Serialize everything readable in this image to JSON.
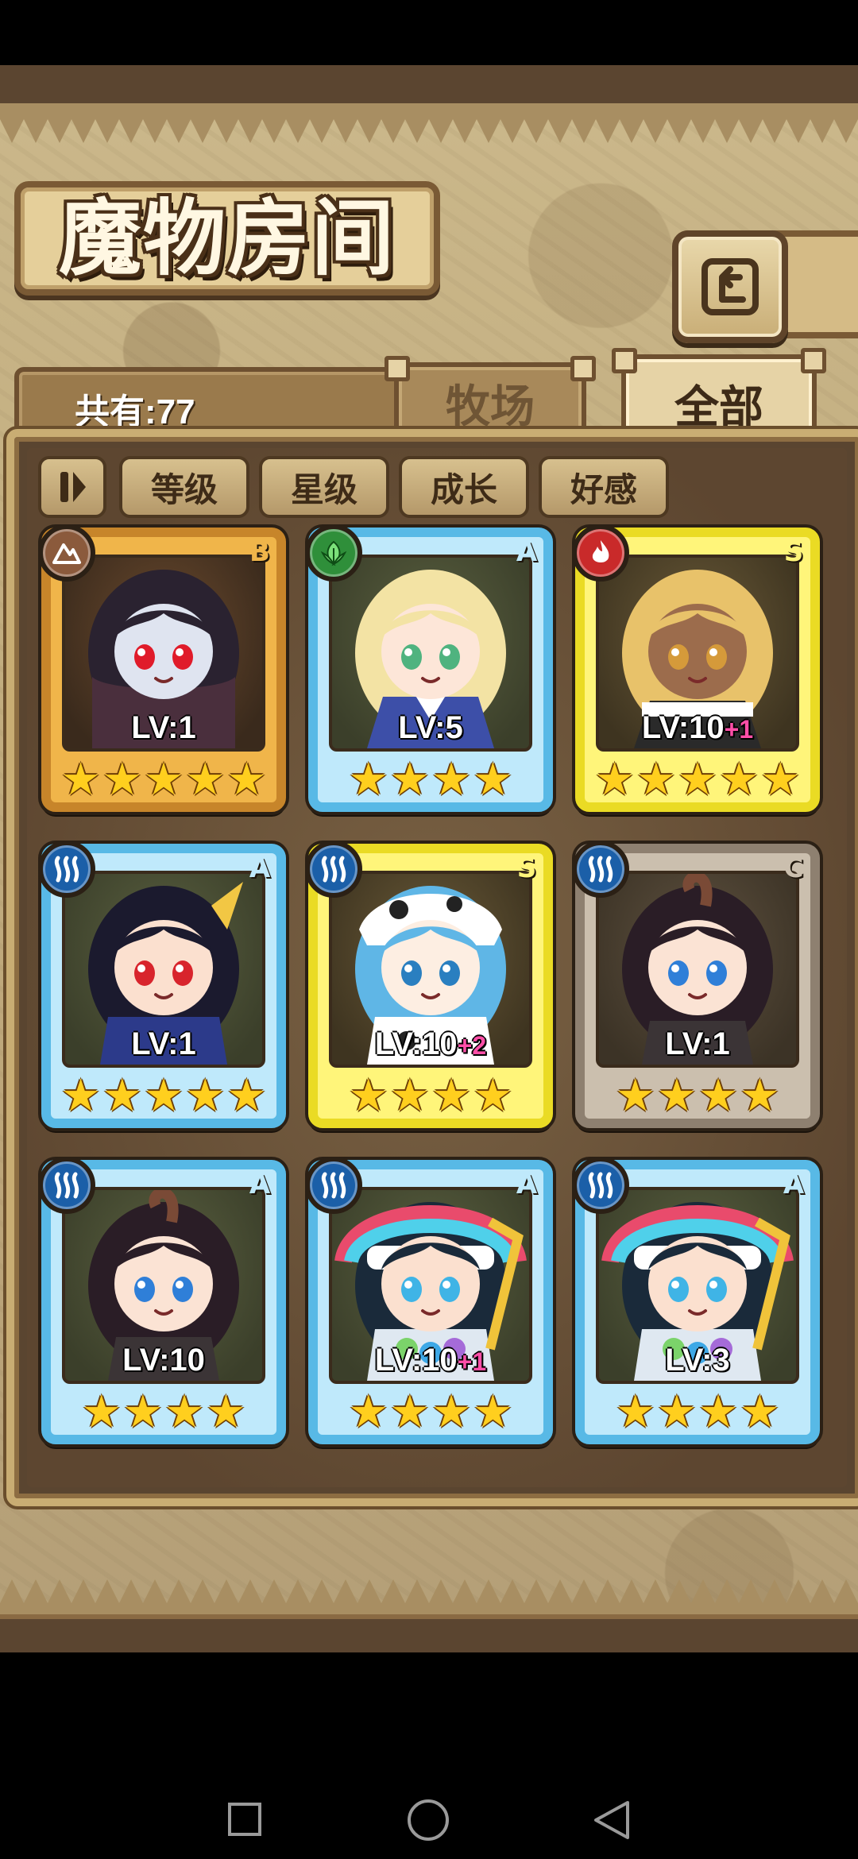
{
  "title": "魔物房间",
  "count_label": "共有:77",
  "tabs": [
    {
      "label": "牧场",
      "active": false
    },
    {
      "label": "全部",
      "active": true
    }
  ],
  "filters": [
    "等级",
    "星级",
    "成长",
    "好感"
  ],
  "colors": {
    "bronze": "#c7852a",
    "blue": "#58b9e6",
    "gold": "#eadb24",
    "gray": "#8e8070",
    "earth": "#8b5a3c",
    "leaf": "#2f8f3a",
    "fire": "#c92a2a",
    "water": "#1b5fa8"
  },
  "monsters": [
    {
      "rank": "B",
      "frame": "bronze",
      "element": "earth-icon",
      "level": "LV:1",
      "bonus": "",
      "stars": 5,
      "art": "dark-hair-vampire"
    },
    {
      "rank": "A",
      "frame": "blue",
      "element": "leaf-icon",
      "level": "LV:5",
      "bonus": "",
      "stars": 4,
      "art": "blonde-nun"
    },
    {
      "rank": "S",
      "frame": "gold",
      "element": "fire-icon",
      "level": "LV:10",
      "bonus": "+1",
      "stars": 5,
      "art": "tan-maid"
    },
    {
      "rank": "A",
      "frame": "blue",
      "element": "water-icon",
      "level": "LV:1",
      "bonus": "",
      "stars": 5,
      "art": "dragon-boy"
    },
    {
      "rank": "S",
      "frame": "gold",
      "element": "water-icon",
      "level": "LV:10",
      "bonus": "+2",
      "stars": 4,
      "art": "cow-girl"
    },
    {
      "rank": "C",
      "frame": "gray",
      "element": "water-icon",
      "level": "LV:1",
      "bonus": "",
      "stars": 4,
      "art": "horned-girl"
    },
    {
      "rank": "A",
      "frame": "blue",
      "element": "water-icon",
      "level": "LV:10",
      "bonus": "",
      "stars": 4,
      "art": "horned-girl"
    },
    {
      "rank": "A",
      "frame": "blue",
      "element": "water-icon",
      "level": "LV:10",
      "bonus": "+1",
      "stars": 4,
      "art": "feather-shaman"
    },
    {
      "rank": "A",
      "frame": "blue",
      "element": "water-icon",
      "level": "LV:3",
      "bonus": "",
      "stars": 4,
      "art": "feather-shaman"
    }
  ]
}
